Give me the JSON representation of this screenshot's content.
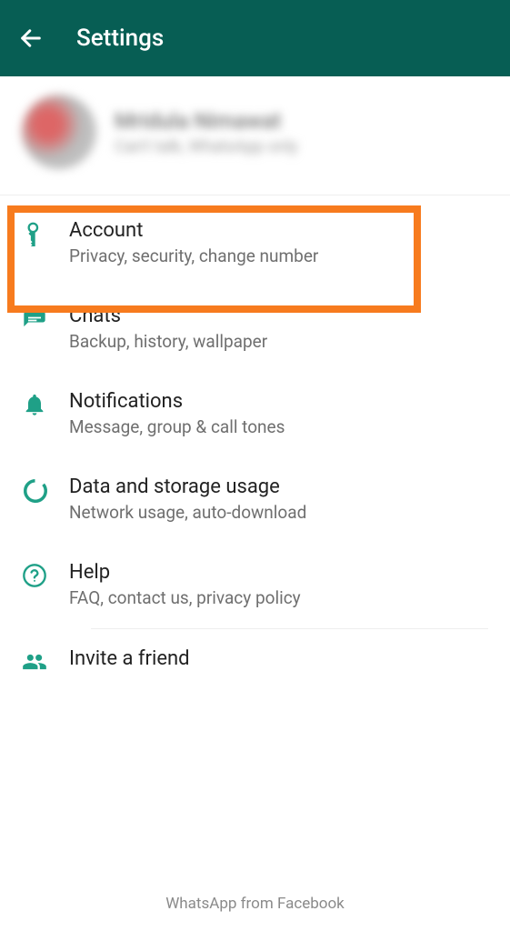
{
  "header": {
    "title": "Settings"
  },
  "profile": {
    "name": "Mridula Nimawat",
    "status": "Can't talk, WhatsApp only"
  },
  "items": [
    {
      "title": "Account",
      "subtitle": "Privacy, security, change number"
    },
    {
      "title": "Chats",
      "subtitle": "Backup, history, wallpaper"
    },
    {
      "title": "Notifications",
      "subtitle": "Message, group & call tones"
    },
    {
      "title": "Data and storage usage",
      "subtitle": "Network usage, auto-download"
    },
    {
      "title": "Help",
      "subtitle": "FAQ, contact us, privacy policy"
    },
    {
      "title": "Invite a friend",
      "subtitle": ""
    }
  ],
  "footer": "WhatsApp from Facebook"
}
